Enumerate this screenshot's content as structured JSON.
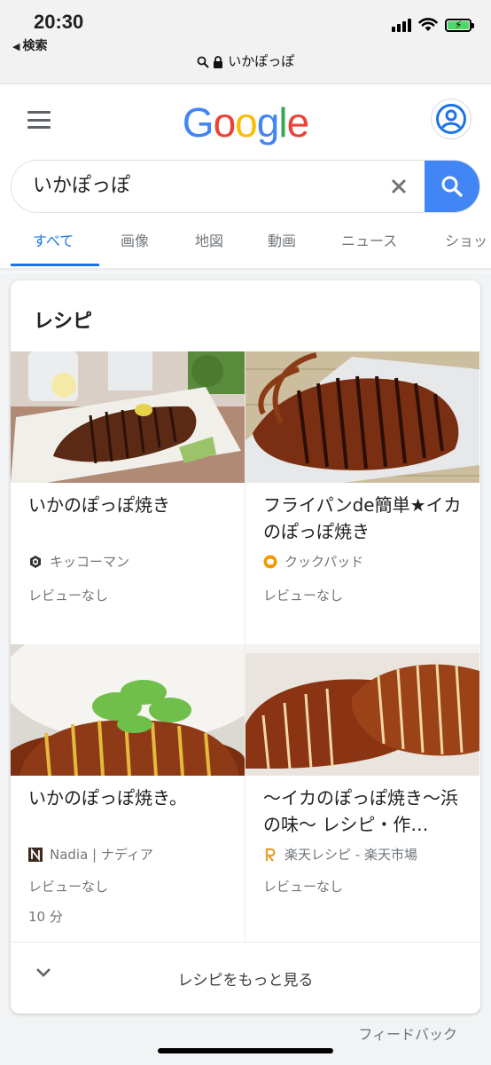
{
  "status_bar": {
    "time": "20:30",
    "back_label": "検索",
    "url": "いかぽっぽ"
  },
  "header": {
    "logo_letters": [
      {
        "ch": "G",
        "color": "#4285F4"
      },
      {
        "ch": "o",
        "color": "#EA4335"
      },
      {
        "ch": "o",
        "color": "#FBBC05"
      },
      {
        "ch": "g",
        "color": "#4285F4"
      },
      {
        "ch": "l",
        "color": "#34A853"
      },
      {
        "ch": "e",
        "color": "#EA4335"
      }
    ],
    "search_value": "いかぽっぽ",
    "tabs": [
      "すべて",
      "画像",
      "地図",
      "動画",
      "ニュース",
      "ショッ"
    ],
    "active_tab": "すべて"
  },
  "recipes_card": {
    "title": "レシピ",
    "items": [
      {
        "name": "いかのぽっぽ焼き",
        "source": "キッコーマン",
        "source_icon": "kikkoman-icon",
        "review": "レビューなし",
        "time": ""
      },
      {
        "name": "フライパンde簡単★イカのぽっぽ焼き",
        "source": "クックパッド",
        "source_icon": "cookpad-icon",
        "review": "レビューなし",
        "time": ""
      },
      {
        "name": "いかのぽっぽ焼き。",
        "source": "Nadia | ナディア",
        "source_icon": "nadia-icon",
        "review": "レビューなし",
        "time": "10 分"
      },
      {
        "name": "〜イカのぽっぽ焼き〜浜の味〜 レシピ・作…",
        "source": "楽天レシピ - 楽天市場",
        "source_icon": "rakuten-icon",
        "review": "レビューなし",
        "time": ""
      }
    ],
    "more_label": "レシピをもっと見る"
  },
  "feedback_label": "フィードバック",
  "colors": {
    "accent": "#1a73e8",
    "search_button": "#4285f4",
    "battery": "#4cd964"
  }
}
